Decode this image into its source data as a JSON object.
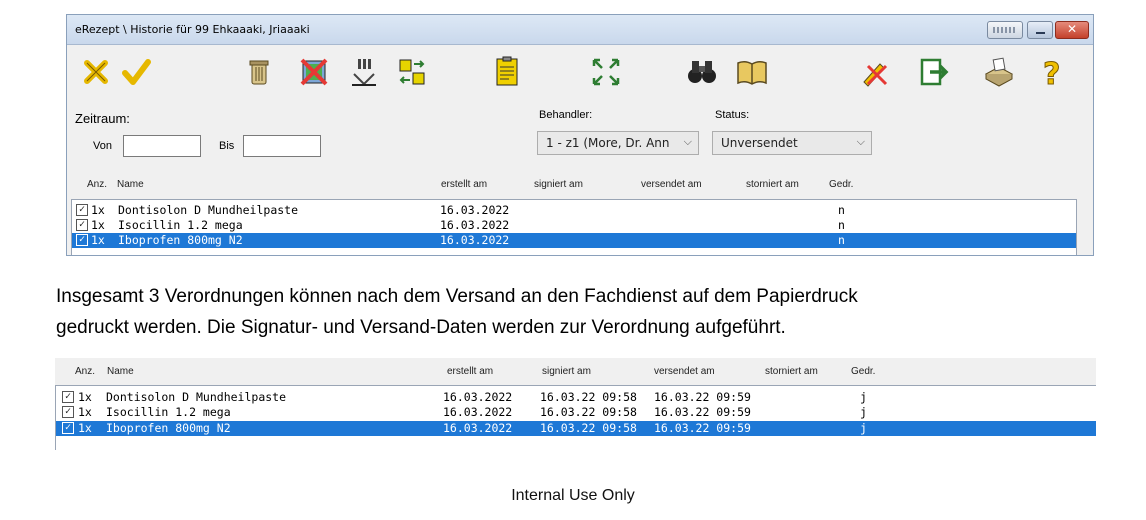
{
  "window": {
    "title": "eRezept \\ Historie für 99 Ehkaaaki, Jriaaaki",
    "accent": "#1e78d6"
  },
  "toolbar": {
    "icons": [
      "cancel-x-icon",
      "check-icon",
      "trash-icon",
      "delete-icon",
      "signature-icon",
      "transfer-icon",
      "form-icon",
      "expand-icon",
      "binoculars-icon",
      "book-icon",
      "pen-cancel-icon",
      "exit-icon",
      "print-icon",
      "help-icon"
    ]
  },
  "filter": {
    "zeitraum_label": "Zeitraum:",
    "von_label": "Von",
    "von_value": "",
    "bis_label": "Bis",
    "bis_value": "",
    "behandler_label": "Behandler:",
    "behandler_value": "1 - z1 (More, Dr. Ann",
    "status_label": "Status:",
    "status_value": "Unversendet"
  },
  "columns": {
    "anz": "Anz.",
    "name": "Name",
    "erstellt": "erstellt am",
    "signiert": "signiert am",
    "versendet": "versendet am",
    "storniert": "storniert am",
    "gedr": "Gedr."
  },
  "list1": {
    "rows": [
      {
        "check": "☑",
        "anz": "1x",
        "name": "Dontisolon D Mundheilpaste",
        "erstellt": "16.03.2022",
        "signiert": "",
        "versendet": "",
        "storniert": "",
        "gedr": "n",
        "selected": false
      },
      {
        "check": "☑",
        "anz": "1x",
        "name": "Isocillin 1.2 mega",
        "erstellt": "16.03.2022",
        "signiert": "",
        "versendet": "",
        "storniert": "",
        "gedr": "n",
        "selected": false
      },
      {
        "check": "☑",
        "anz": "1x",
        "name": "Iboprofen 800mg N2",
        "erstellt": "16.03.2022",
        "signiert": "",
        "versendet": "",
        "storniert": "",
        "gedr": "n",
        "selected": true
      }
    ]
  },
  "explanation": {
    "line1": "Insgesamt 3 Verordnungen können nach dem Versand an den Fachdienst auf dem Papierdruck",
    "line2": "gedruckt werden. Die Signatur- und Versand-Daten werden zur Verordnung aufgeführt."
  },
  "list2": {
    "rows": [
      {
        "check": "☑",
        "anz": "1x",
        "name": "Dontisolon D Mundheilpaste",
        "erstellt": "16.03.2022",
        "signiert": "16.03.22 09:58",
        "versendet": "16.03.22 09:59",
        "storniert": "",
        "gedr": "j",
        "selected": false
      },
      {
        "check": "☑",
        "anz": "1x",
        "name": "Isocillin 1.2 mega",
        "erstellt": "16.03.2022",
        "signiert": "16.03.22 09:58",
        "versendet": "16.03.22 09:59",
        "storniert": "",
        "gedr": "j",
        "selected": false
      },
      {
        "check": "☑",
        "anz": "1x",
        "name": "Iboprofen 800mg N2",
        "erstellt": "16.03.2022",
        "signiert": "16.03.22 09:58",
        "versendet": "16.03.22 09:59",
        "storniert": "",
        "gedr": "j",
        "selected": true
      }
    ]
  },
  "footer": {
    "text": "Internal Use Only"
  }
}
